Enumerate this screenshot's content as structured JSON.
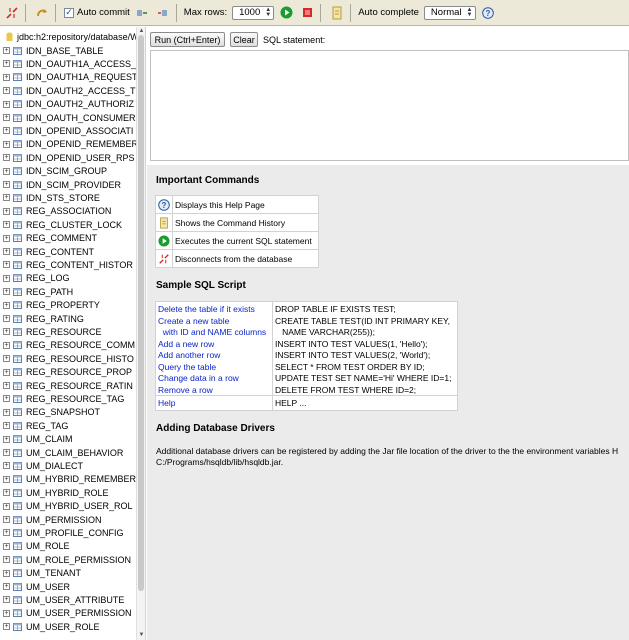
{
  "toolbar": {
    "auto_commit_label": "Auto commit",
    "auto_commit_checked": true,
    "max_rows_label": "Max rows:",
    "max_rows_value": "1000",
    "auto_complete_label": "Auto complete",
    "auto_complete_value": "Normal",
    "accent_green": "#1c9b2e",
    "accent_red": "#d32b2b"
  },
  "tree": {
    "root": "jdbc:h2:repository/database/W",
    "tables": [
      "IDN_BASE_TABLE",
      "IDN_OAUTH1A_ACCESS_",
      "IDN_OAUTH1A_REQUEST",
      "IDN_OAUTH2_ACCESS_T",
      "IDN_OAUTH2_AUTHORIZ",
      "IDN_OAUTH_CONSUMER",
      "IDN_OPENID_ASSOCIATI",
      "IDN_OPENID_REMEMBER",
      "IDN_OPENID_USER_RPS",
      "IDN_SCIM_GROUP",
      "IDN_SCIM_PROVIDER",
      "IDN_STS_STORE",
      "REG_ASSOCIATION",
      "REG_CLUSTER_LOCK",
      "REG_COMMENT",
      "REG_CONTENT",
      "REG_CONTENT_HISTOR",
      "REG_LOG",
      "REG_PATH",
      "REG_PROPERTY",
      "REG_RATING",
      "REG_RESOURCE",
      "REG_RESOURCE_COMM",
      "REG_RESOURCE_HISTO",
      "REG_RESOURCE_PROP",
      "REG_RESOURCE_RATIN",
      "REG_RESOURCE_TAG",
      "REG_SNAPSHOT",
      "REG_TAG",
      "UM_CLAIM",
      "UM_CLAIM_BEHAVIOR",
      "UM_DIALECT",
      "UM_HYBRID_REMEMBER",
      "UM_HYBRID_ROLE",
      "UM_HYBRID_USER_ROL",
      "UM_PERMISSION",
      "UM_PROFILE_CONFIG",
      "UM_ROLE",
      "UM_ROLE_PERMISSION",
      "UM_TENANT",
      "UM_USER",
      "UM_USER_ATTRIBUTE",
      "UM_USER_PERMISSION",
      "UM_USER_ROLE"
    ]
  },
  "editor": {
    "run_label": "Run (Ctrl+Enter)",
    "clear_label": "Clear",
    "sql_label": "SQL statement:"
  },
  "help": {
    "important_title": "Important Commands",
    "commands": [
      {
        "icon": "help-icon",
        "text": "Displays this Help Page"
      },
      {
        "icon": "history-icon",
        "text": "Shows the Command History"
      },
      {
        "icon": "run-icon",
        "text": "Executes the current SQL statement"
      },
      {
        "icon": "disconnect-icon",
        "text": "Disconnects from the database"
      }
    ],
    "sample_title": "Sample SQL Script",
    "sample_links": [
      "Delete the table if it exists",
      "Create a new table",
      "  with ID and NAME columns",
      "Add a new row",
      "Add another row",
      "Query the table",
      "Change data in a row",
      "Remove a row"
    ],
    "sample_sql": [
      "DROP TABLE IF EXISTS TEST;",
      "CREATE TABLE TEST(ID INT PRIMARY KEY,",
      "   NAME VARCHAR(255));",
      "INSERT INTO TEST VALUES(1, 'Hello');",
      "INSERT INTO TEST VALUES(2, 'World');",
      "SELECT * FROM TEST ORDER BY ID;",
      "UPDATE TEST SET NAME='Hi' WHERE ID=1;",
      "DELETE FROM TEST WHERE ID=2;"
    ],
    "help_link": "Help",
    "help_sql": "HELP ...",
    "drivers_title": "Adding Database Drivers",
    "drivers_line1": "Additional database drivers can be registered by adding the Jar file location of the driver to the the environment variables H",
    "drivers_line2": "C:/Programs/hsqldb/lib/hsqldb.jar."
  }
}
